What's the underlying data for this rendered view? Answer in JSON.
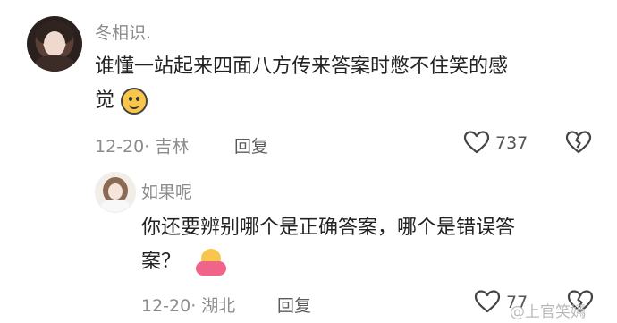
{
  "comment1": {
    "username": "冬相识.",
    "text_line1": "谁懂一站起来四面八方传来答案时憋不住笑的感",
    "text_line2": "觉",
    "date_location": "12-20· 吉林",
    "reply_label": "回复",
    "like_count": "737"
  },
  "comment2": {
    "username": "如果呢",
    "text_line1": "你还要辨别哪个是正确答案，哪个是错误答",
    "text_line2": "案？",
    "date_location": "12-20· 湖北",
    "reply_label": "回复",
    "like_count": "77"
  },
  "watermark": {
    "text": "@上官笑嫣"
  },
  "icons": {
    "like": "heart-outline-icon",
    "dislike": "broken-heart-icon"
  },
  "colors": {
    "muted_text": "#8c8c8c",
    "body_text": "#222222",
    "background": "#ffffff"
  }
}
